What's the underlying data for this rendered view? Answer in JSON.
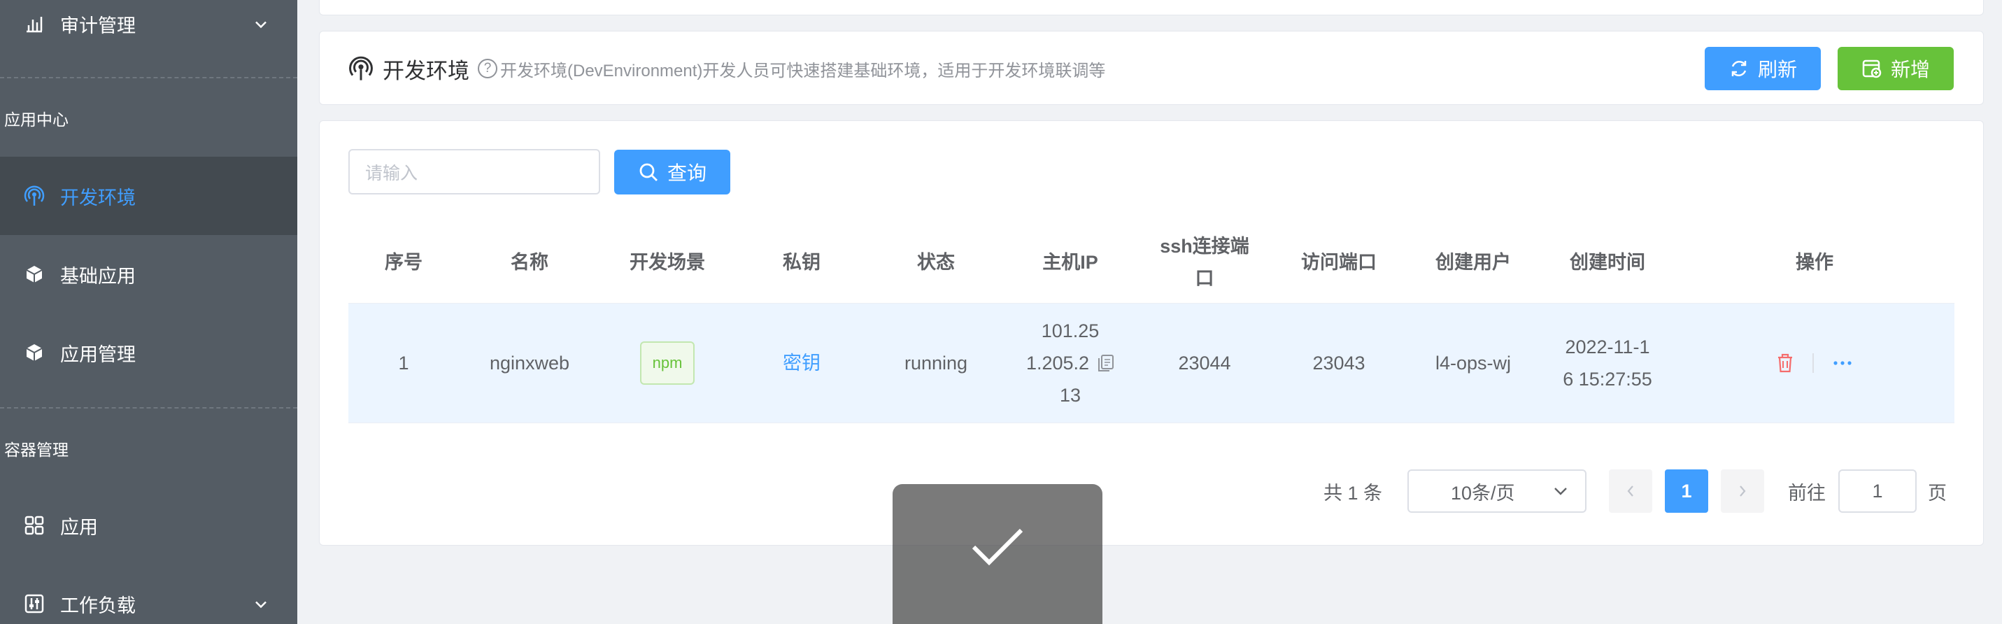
{
  "sidebar": {
    "top_item": {
      "label": "审计管理",
      "icon": "bar-chart-icon"
    },
    "group_app_center": "应用中心",
    "items": [
      {
        "label": "开发环境",
        "icon": "broadcast-icon",
        "active": true
      },
      {
        "label": "基础应用",
        "icon": "cube-icon"
      },
      {
        "label": "应用管理",
        "icon": "cube-icon"
      }
    ],
    "group_container": "容器管理",
    "container_items": [
      {
        "label": "应用",
        "icon": "grid-icon"
      },
      {
        "label": "工作负载",
        "icon": "sliders-icon"
      }
    ]
  },
  "header": {
    "title": "开发环境",
    "description": "开发环境(DevEnvironment)开发人员可快速搭建基础环境，适用于开发环境联调等",
    "refresh_label": "刷新",
    "add_label": "新增"
  },
  "search": {
    "placeholder": "请输入",
    "button_label": "查询"
  },
  "table": {
    "columns": [
      "序号",
      "名称",
      "开发场景",
      "私钥",
      "状态",
      "主机IP",
      "ssh连接端口",
      "访问端口",
      "创建用户",
      "创建时间",
      "操作"
    ],
    "columns_display": {
      "ssh_line1": "ssh连接端",
      "ssh_line2": "口"
    },
    "rows": [
      {
        "index": "1",
        "name": "nginxweb",
        "scene": "npm",
        "key": "密钥",
        "status": "running",
        "host_ip": "101.251.205.213",
        "host_ip_line1": "101.25",
        "host_ip_line2": "1.205.2",
        "host_ip_line3": "13",
        "ssh_port": "23044",
        "access_port": "23043",
        "creator": "l4-ops-wj",
        "created_at": "2022-11-16 15:27:55",
        "created_line1": "2022-11-1",
        "created_line2": "6 15:27:55"
      }
    ]
  },
  "pagination": {
    "total_text": "共 1 条",
    "page_size": "10条/页",
    "current_page": "1",
    "goto_label": "前往",
    "goto_value": "1",
    "page_suffix": "页"
  },
  "colors": {
    "primary": "#409eff",
    "success": "#67c23a",
    "danger": "#f56c6c",
    "sidebar_bg": "#545c64"
  }
}
